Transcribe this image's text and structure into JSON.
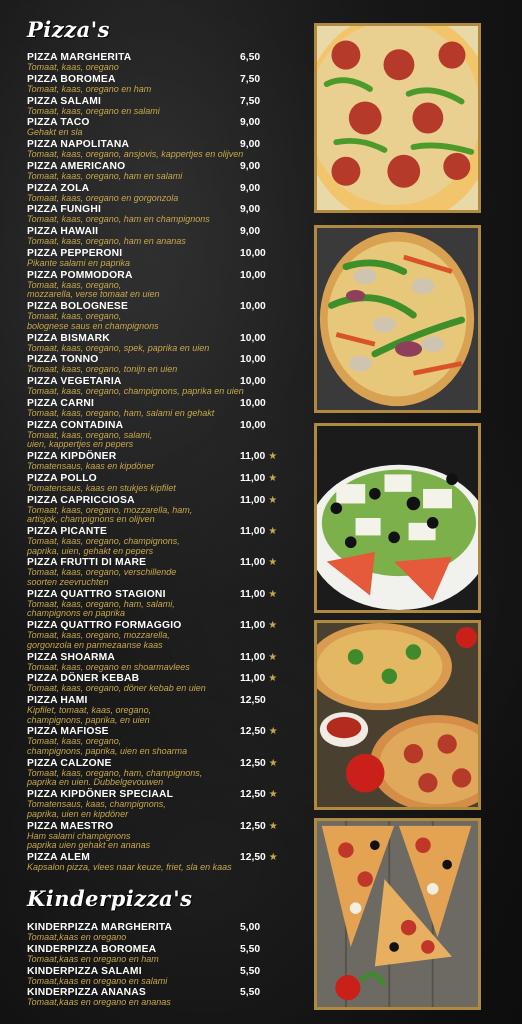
{
  "pizzas": {
    "heading": "Pizza's",
    "items": [
      {
        "name": "PIZZA MARGHERITA",
        "price": "6,50",
        "star": false,
        "desc": [
          "Tomaat, kaas, oregano"
        ]
      },
      {
        "name": "PIZZA BOROMEA",
        "price": "7,50",
        "star": false,
        "desc": [
          "Tomaat, kaas, oregano en ham"
        ]
      },
      {
        "name": "PIZZA SALAMI",
        "price": "7,50",
        "star": false,
        "desc": [
          "Tomaat, kaas, oregano en salami"
        ]
      },
      {
        "name": "PIZZA TACO",
        "price": "9,00",
        "star": false,
        "desc": [
          "Gehakt en sla"
        ]
      },
      {
        "name": "PIZZA NAPOLITANA",
        "price": "9,00",
        "star": false,
        "desc": [
          "Tomaat, kaas, oregano, ansjovis, kappertjes en olijven"
        ]
      },
      {
        "name": "PIZZA AMERICANO",
        "price": "9,00",
        "star": false,
        "desc": [
          "Tomaat, kaas, oregano, ham en salami"
        ]
      },
      {
        "name": "PIZZA ZOLA",
        "price": "9,00",
        "star": false,
        "desc": [
          "Tomaat, kaas, oregano en gorgonzola"
        ]
      },
      {
        "name": "PIZZA FUNGHI",
        "price": "9,00",
        "star": false,
        "desc": [
          "Tomaat, kaas, oregano, ham en champignons"
        ]
      },
      {
        "name": "PIZZA HAWAII",
        "price": "9,00",
        "star": false,
        "desc": [
          "Tomaat, kaas, oregano, ham en ananas"
        ]
      },
      {
        "name": "PIZZA PEPPERONI",
        "price": "10,00",
        "star": false,
        "desc": [
          "Pikante salami en paprika"
        ]
      },
      {
        "name": "PIZZA POMMODORA",
        "price": "10,00",
        "star": false,
        "desc": [
          "Tomaat, kaas, oregano,",
          "mozzarella, verse tomaat en uien"
        ]
      },
      {
        "name": "PIZZA BOLOGNESE",
        "price": "10,00",
        "star": false,
        "desc": [
          "Tomaat, kaas, oregano,",
          "bolognese saus en champignons"
        ]
      },
      {
        "name": "PIZZA BISMARK",
        "price": "10,00",
        "star": false,
        "desc": [
          "Tomaat, kaas, oregano, spek, paprika en uien"
        ]
      },
      {
        "name": "PIZZA TONNO",
        "price": "10,00",
        "star": false,
        "desc": [
          "Tomaat, kaas, oregano, tonijn en uien"
        ]
      },
      {
        "name": "PIZZA VEGETARIA",
        "price": "10,00",
        "star": false,
        "desc": [
          "Tomaat, kaas, oregano, champignons, paprika en uien"
        ]
      },
      {
        "name": "PIZZA CARNI",
        "price": "10,00",
        "star": false,
        "desc": [
          "Tomaat, kaas, oregano, ham, salami en gehakt"
        ]
      },
      {
        "name": "PIZZA CONTADINA",
        "price": "10,00",
        "star": false,
        "desc": [
          "Tomaat, kaas, oregano, salami,",
          "uien, kappertjes en pepers"
        ]
      },
      {
        "name": "PIZZA KIPDÖNER",
        "price": "11,00",
        "star": true,
        "desc": [
          "Tomatensaus, kaas en kipdöner"
        ]
      },
      {
        "name": "PIZZA POLLO",
        "price": "11,00",
        "star": true,
        "desc": [
          "Tomatensaus, kaas en stukjes kipfilet"
        ]
      },
      {
        "name": "PIZZA CAPRICCIOSA",
        "price": "11,00",
        "star": true,
        "desc": [
          "Tomaat, kaas, oregano, mozzarella, ham,",
          "artisjok, champignons en olijven"
        ]
      },
      {
        "name": "PIZZA PICANTE",
        "price": "11,00",
        "star": true,
        "desc": [
          "Tomaat, kaas, oregano, champignons,",
          "paprika, uien, gehakt en pepers"
        ]
      },
      {
        "name": "PIZZA FRUTTI DI MARE",
        "price": "11,00",
        "star": true,
        "desc": [
          "Tomaat, kaas, oregano, verschillende",
          "soorten zeevruchten"
        ]
      },
      {
        "name": "PIZZA QUATTRO STAGIONI",
        "price": "11,00",
        "star": true,
        "desc": [
          "Tomaat, kaas, oregano, ham, salami,",
          "champignons en paprika"
        ]
      },
      {
        "name": "PIZZA QUATTRO FORMAGGIO",
        "price": "11,00",
        "star": true,
        "desc": [
          "Tomaat, kaas, oregano, mozzarella,",
          "gorgonzola en parmezaanse kaas"
        ]
      },
      {
        "name": "PIZZA SHOARMA",
        "price": "11,00",
        "star": true,
        "desc": [
          "Tomaat, kaas, oregano en shoarmavlees"
        ]
      },
      {
        "name": "PIZZA DÖNER KEBAB",
        "price": "11,00",
        "star": true,
        "desc": [
          "Tomaat, kaas, oregano, döner kebab en uien"
        ]
      },
      {
        "name": "PIZZA HAMI",
        "price": "12,50",
        "star": false,
        "desc": [
          "Kipfilet, tomaat, kaas, oregano,",
          "champignons, paprika, en uien"
        ]
      },
      {
        "name": "PIZZA MAFIOSE",
        "price": "12,50",
        "star": true,
        "desc": [
          "Tomaat, kaas, oregano,",
          "champignons, paprika, uien en shoarma"
        ]
      },
      {
        "name": "PIZZA CALZONE",
        "price": "12,50",
        "star": true,
        "desc": [
          "Tomaat, kaas, oregano, ham, champignons,",
          "paprika en uien. Dubbelgevouwen"
        ]
      },
      {
        "name": "PIZZA KIPDÖNER SPECIAAL",
        "price": "12,50",
        "star": true,
        "desc": [
          "Tomatensaus, kaas, champignons,",
          "paprika, uien en kipdöner"
        ]
      },
      {
        "name": "PIZZA MAESTRO",
        "price": "12,50",
        "star": true,
        "desc": [
          "Ham salami champignons",
          "paprika uien gehakt en ananas"
        ]
      },
      {
        "name": "PIZZA ALEM",
        "price": "12,50",
        "star": true,
        "desc": [
          "Kapsalon pizza, vlees naar keuze, friet, sla en kaas"
        ]
      }
    ]
  },
  "kids": {
    "heading": "Kinderpizza's",
    "items": [
      {
        "name": "KINDERPIZZA MARGHERITA",
        "price": "5,00",
        "star": false,
        "desc": [
          "Tomaat,kaas en oregano"
        ]
      },
      {
        "name": "KINDERPIZZA BOROMEA",
        "price": "5,50",
        "star": false,
        "desc": [
          "Tomaat,kaas en oregano en ham"
        ]
      },
      {
        "name": "KINDERPIZZA SALAMI",
        "price": "5,50",
        "star": false,
        "desc": [
          "Tomaat,kaas en oregano en salami"
        ]
      },
      {
        "name": "KINDERPIZZA ANANAS",
        "price": "5,50",
        "star": false,
        "desc": [
          "Tomaat,kaas en oregano en ananas"
        ]
      }
    ]
  },
  "star_symbol": "★",
  "colors": {
    "accent": "#c9a84a",
    "frame": "#b08a3e",
    "background": "#171717"
  },
  "photos": [
    "pizza-salami-photo",
    "pizza-vegetaria-photo",
    "greek-salad-photo",
    "pizza-assortment-photo",
    "pizza-slices-photo"
  ]
}
